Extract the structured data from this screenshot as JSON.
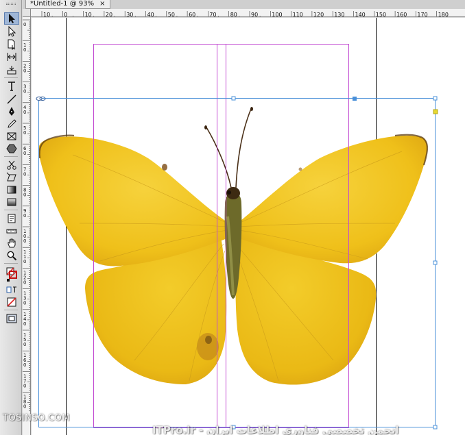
{
  "document_tab": {
    "title": "*Untitled-1 @ 93%",
    "close_glyph": "×"
  },
  "toolbar": {
    "tools": [
      {
        "name": "selection-tool-icon",
        "active": true
      },
      {
        "name": "direct-selection-tool-icon"
      },
      {
        "name": "page-tool-icon"
      },
      {
        "name": "gap-tool-icon"
      },
      {
        "name": "content-collector-icon"
      },
      {
        "name": "type-tool-icon"
      },
      {
        "name": "line-tool-icon"
      },
      {
        "name": "pen-tool-icon"
      },
      {
        "name": "pencil-tool-icon"
      },
      {
        "name": "rectangle-frame-tool-icon"
      },
      {
        "name": "polygon-tool-icon"
      },
      {
        "name": "scissors-tool-icon"
      },
      {
        "name": "free-transform-tool-icon"
      },
      {
        "name": "gradient-swatch-tool-icon"
      },
      {
        "name": "gradient-feather-tool-icon"
      },
      {
        "name": "note-tool-icon"
      },
      {
        "name": "measure-tool-icon"
      },
      {
        "name": "hand-tool-icon"
      },
      {
        "name": "zoom-tool-icon"
      },
      {
        "name": "fill-stroke-icon"
      },
      {
        "name": "formatting-affects-container-icon"
      },
      {
        "name": "apply-none-icon"
      },
      {
        "name": "screen-mode-icon"
      }
    ]
  },
  "ruler": {
    "horizontal_labels": [
      "10",
      "0",
      "10",
      "20",
      "30",
      "40",
      "50",
      "60",
      "70",
      "80",
      "90",
      "100",
      "110",
      "120",
      "130",
      "140",
      "150",
      "160",
      "170",
      "180"
    ],
    "vertical_labels": [
      "0",
      "10",
      "20",
      "30",
      "40",
      "50",
      "60",
      "70",
      "80",
      "90",
      "100",
      "110",
      "120",
      "130",
      "140",
      "150",
      "160",
      "170",
      "180"
    ]
  },
  "watermark": {
    "left": "TOSINSO.COM",
    "center": "ITPro.ir - انجمن تخصصی فناوری اطلاعات ایران"
  },
  "colors": {
    "wing": "#f0c419",
    "wing_dark": "#d9a20a",
    "frame_selection": "#4a90d9",
    "margin_guide": "#c24ad2",
    "page_edge": "#000000"
  }
}
